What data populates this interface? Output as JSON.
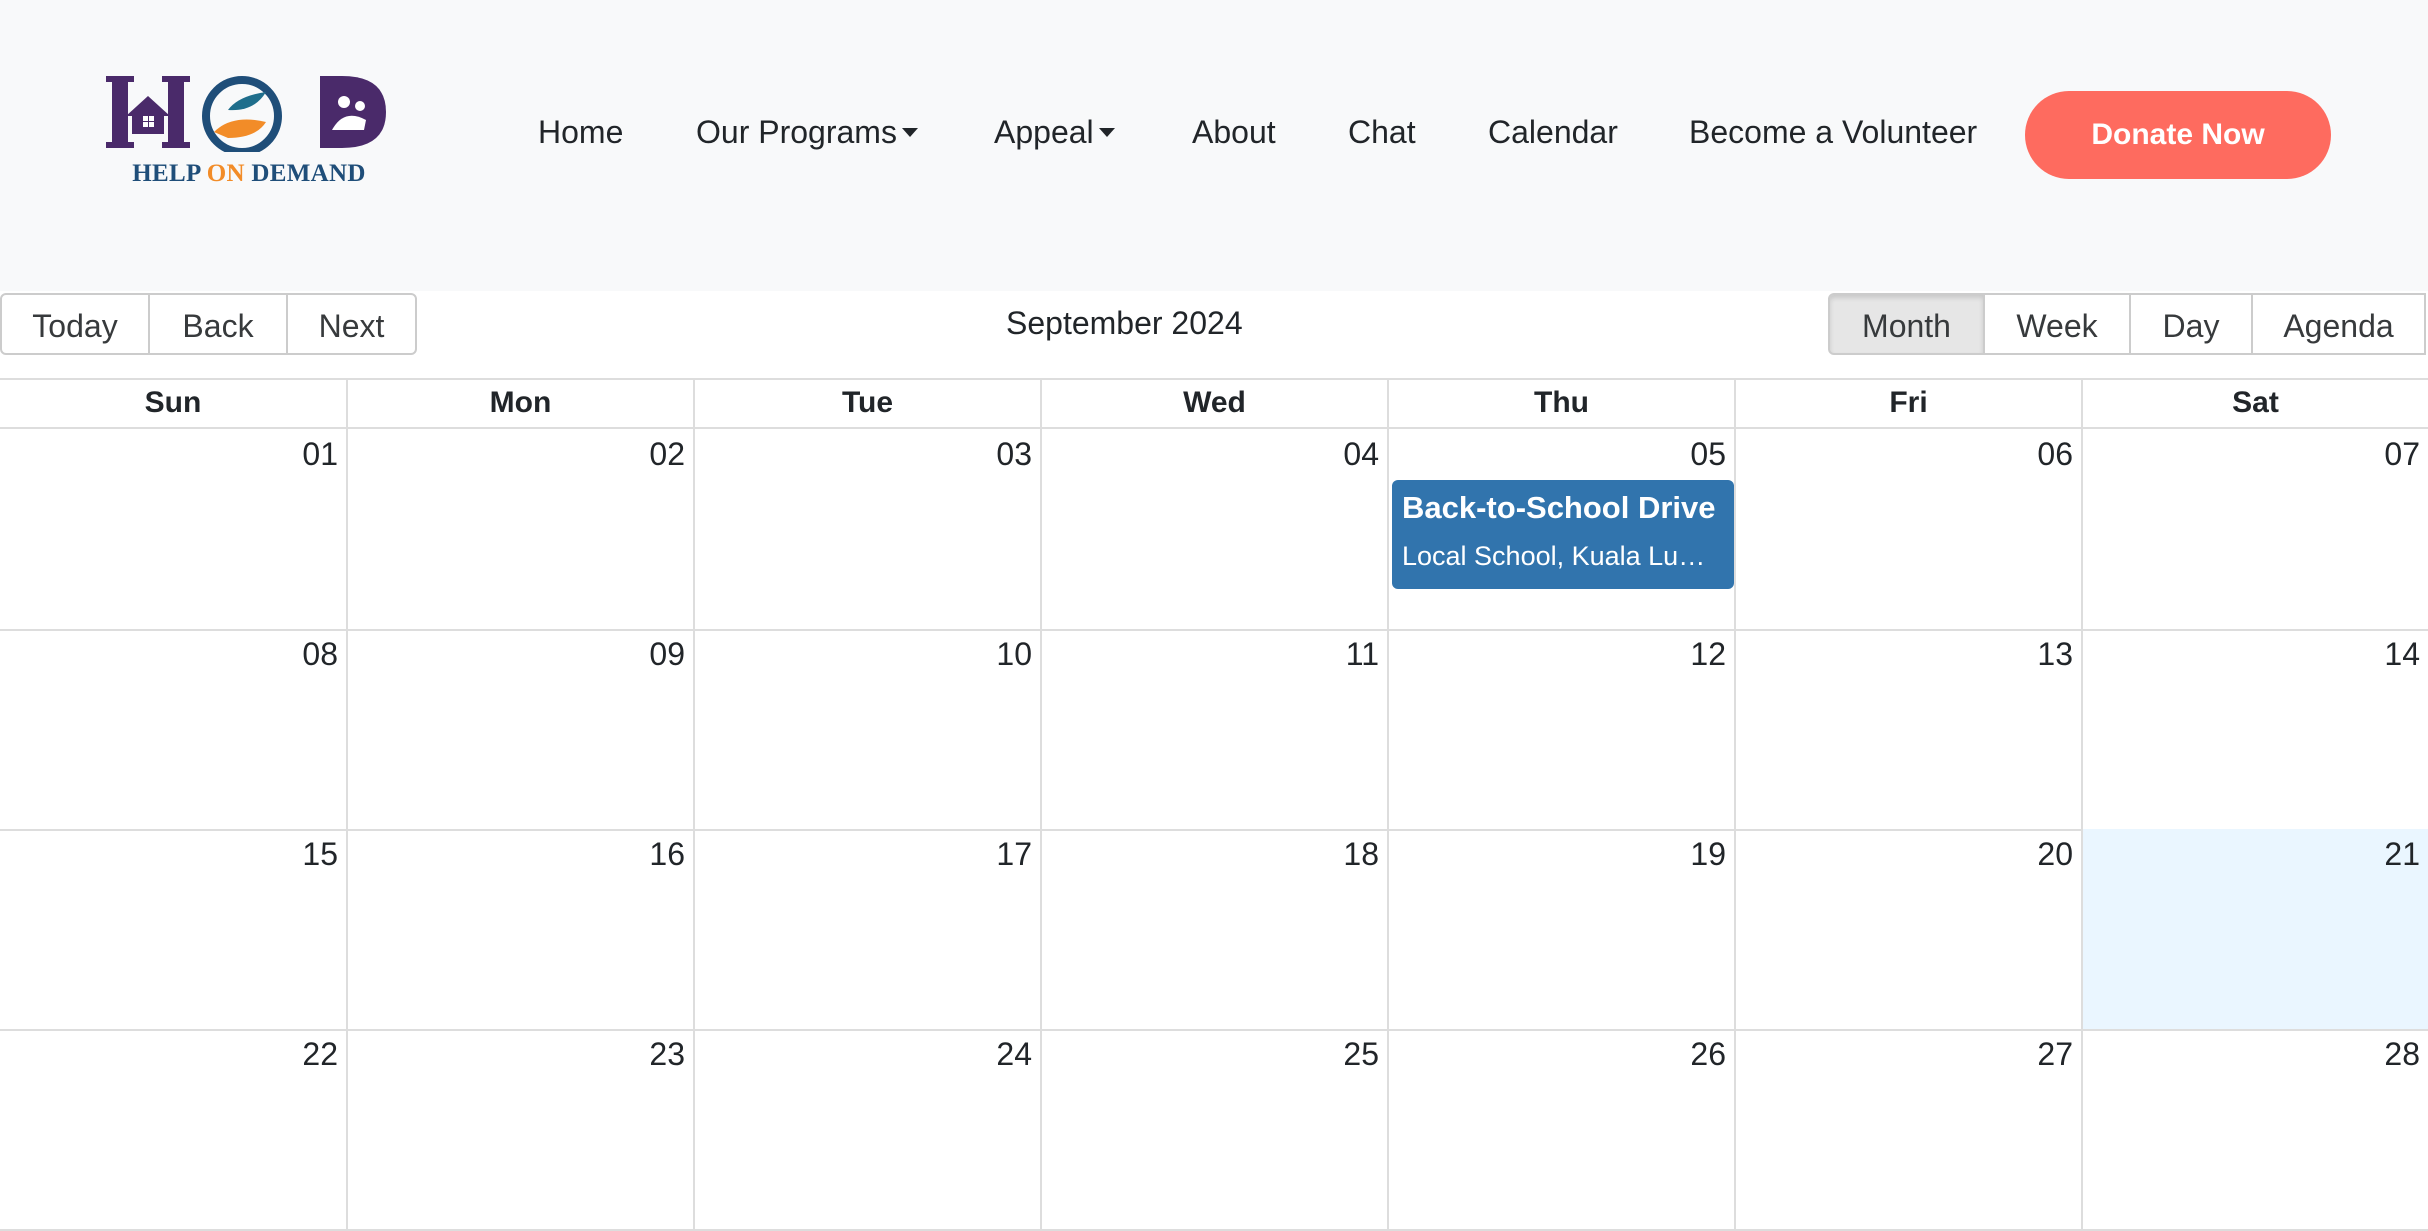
{
  "brand": {
    "logo_text_1": "HELP ",
    "logo_text_2": "ON",
    "logo_text_3": " DEMAND",
    "colors": {
      "purple": "#4a2a6a",
      "orange": "#f28c28",
      "navy": "#1f4e79"
    }
  },
  "nav": {
    "items": [
      {
        "label": "Home"
      },
      {
        "label": "Our Programs"
      },
      {
        "label": "Appeal"
      },
      {
        "label": "About"
      },
      {
        "label": "Chat"
      },
      {
        "label": "Calendar"
      },
      {
        "label": "Become a Volunteer"
      }
    ],
    "donate_label": "Donate Now",
    "donate_color": "#fe6b5f"
  },
  "toolbar": {
    "today": "Today",
    "back": "Back",
    "next": "Next",
    "label": "September 2024",
    "views": [
      "Month",
      "Week",
      "Day",
      "Agenda"
    ],
    "active_view": "Month"
  },
  "calendar": {
    "weekdays": [
      "Sun",
      "Mon",
      "Tue",
      "Wed",
      "Thu",
      "Fri",
      "Sat"
    ],
    "weeks": [
      [
        "01",
        "02",
        "03",
        "04",
        "05",
        "06",
        "07"
      ],
      [
        "08",
        "09",
        "10",
        "11",
        "12",
        "13",
        "14"
      ],
      [
        "15",
        "16",
        "17",
        "18",
        "19",
        "20",
        "21"
      ],
      [
        "22",
        "23",
        "24",
        "25",
        "26",
        "27",
        "28"
      ]
    ],
    "today": "21",
    "event": {
      "title": "Back-to-School Drive",
      "location": "Local School, Kuala Lumpur",
      "date": "05",
      "color": "#3174ad"
    }
  }
}
